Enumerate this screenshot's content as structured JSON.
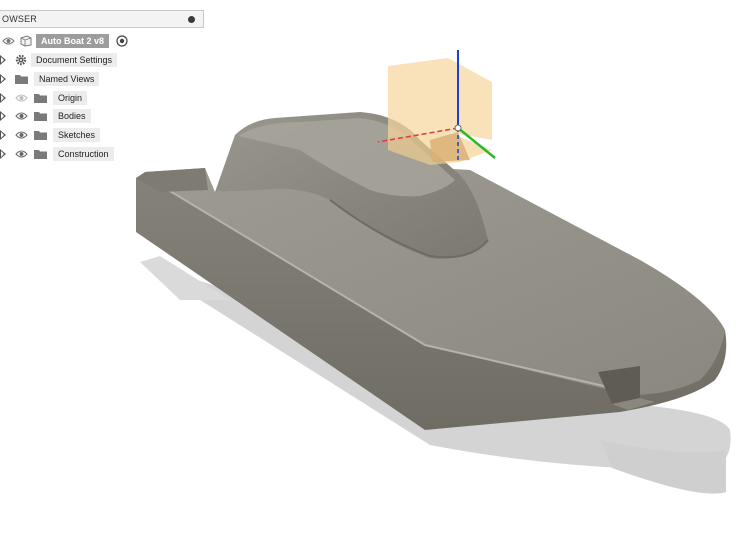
{
  "browser": {
    "title": "OWSER",
    "root": {
      "label": "Auto Boat 2 v8"
    },
    "items": [
      {
        "label": "Document Settings",
        "icon": "gear-icon",
        "eye": false
      },
      {
        "label": "Named Views",
        "icon": "folder-icon",
        "eye": false
      },
      {
        "label": "Origin",
        "icon": "folder-icon",
        "eye": true,
        "eye_state": "hidden"
      },
      {
        "label": "Bodies",
        "icon": "folder-icon",
        "eye": true,
        "eye_state": "visible"
      },
      {
        "label": "Sketches",
        "icon": "folder-icon",
        "eye": true,
        "eye_state": "visible"
      },
      {
        "label": "Construction",
        "icon": "folder-icon",
        "eye": true,
        "eye_state": "visible"
      }
    ]
  },
  "colors": {
    "hull_top": "#8e8b83",
    "hull_side": "#7b7870",
    "hull_deck": "#a29f97",
    "shadow": "#d3d3d3",
    "origin_plane": "#f7d8a3",
    "axis_x": "#e53935",
    "axis_y": "#2eb82e",
    "axis_z": "#1f3fd6",
    "panel_header": "#f3f3f3"
  }
}
